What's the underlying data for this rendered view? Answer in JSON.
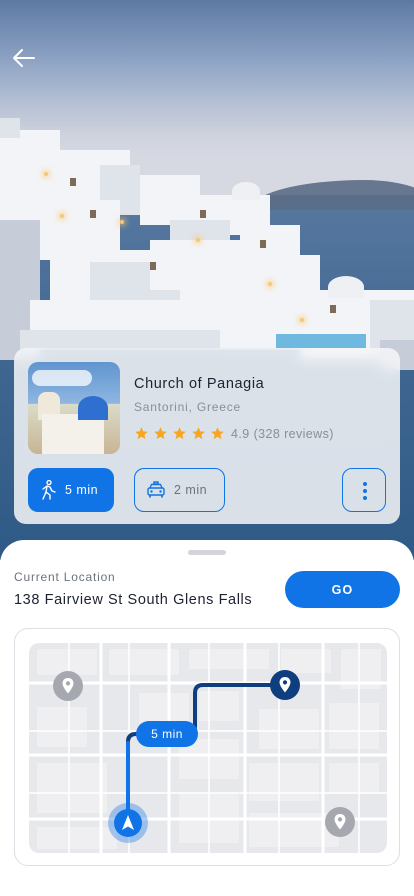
{
  "header": {
    "back_icon": "arrow-left-icon"
  },
  "place": {
    "name": "Church of Panagia",
    "location": "Santorini, Greece",
    "stars": 5,
    "rating": "4.9",
    "reviews": "(328 reviews)",
    "star_color": "#f5a623"
  },
  "travel_modes": [
    {
      "icon": "walk-icon",
      "label": "5 min",
      "selected": true
    },
    {
      "icon": "taxi-icon",
      "label": "2 min",
      "selected": false
    }
  ],
  "more_icon": "more-vertical-icon",
  "current_location": {
    "label": "Current Location",
    "address": "138 Fairview St South Glens Falls",
    "go_label": "GO"
  },
  "map": {
    "route_duration": "5 min",
    "markers": [
      "user-location-icon",
      "destination-pin-icon",
      "pin-icon",
      "pin-icon"
    ]
  },
  "colors": {
    "accent": "#1174e6",
    "route": "#0f3e7e"
  }
}
